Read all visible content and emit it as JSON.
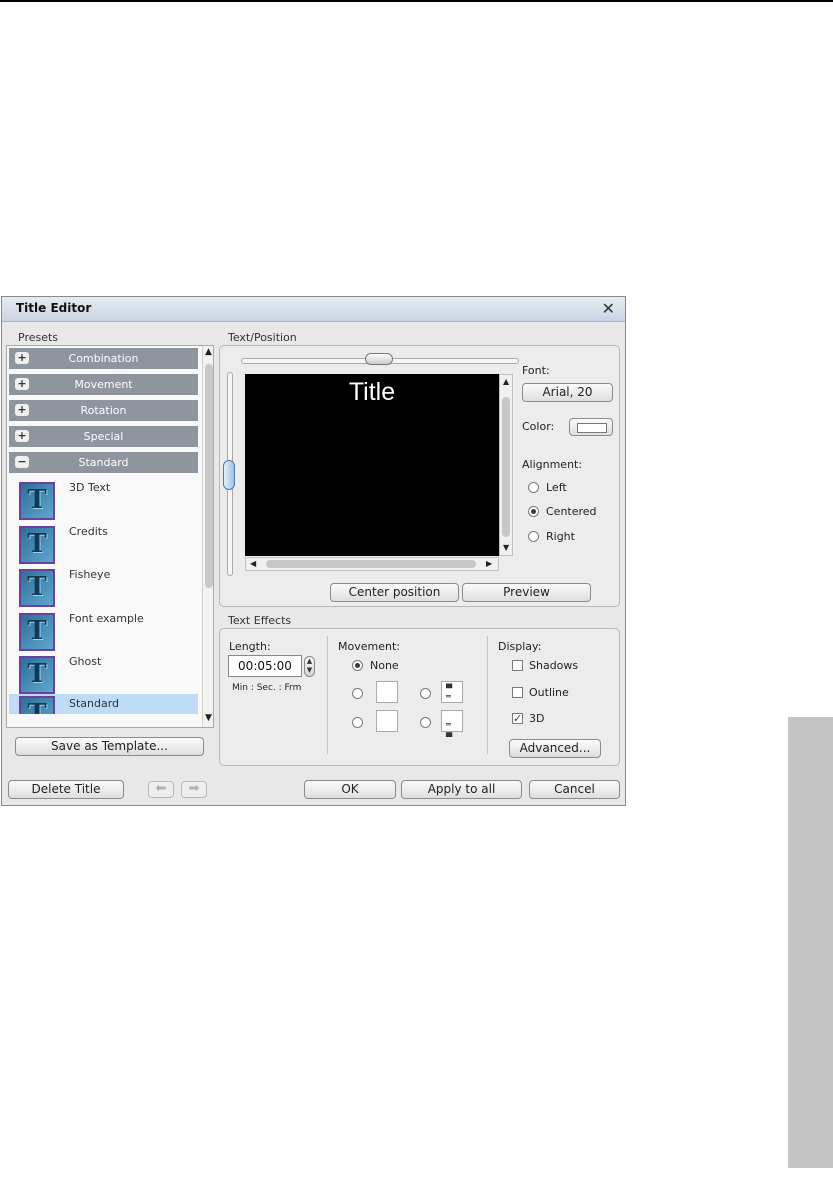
{
  "dialog": {
    "title": "Title Editor",
    "close": "✕"
  },
  "presets": {
    "label": "Presets",
    "categories": [
      {
        "label": "Combination",
        "toggle": "+"
      },
      {
        "label": "Movement",
        "toggle": "+"
      },
      {
        "label": "Rotation",
        "toggle": "+"
      },
      {
        "label": "Special",
        "toggle": "+"
      },
      {
        "label": "Standard",
        "toggle": "−"
      }
    ],
    "items": [
      {
        "label": "3D Text",
        "icon": "T"
      },
      {
        "label": "Credits",
        "icon": "T"
      },
      {
        "label": "Fisheye",
        "icon": "T"
      },
      {
        "label": "Font example",
        "icon": "T"
      },
      {
        "label": "Ghost",
        "icon": "T"
      },
      {
        "label": "Standard",
        "icon": "T",
        "selected": true
      }
    ],
    "save_template": "Save as Template..."
  },
  "text_position": {
    "label": "Text/Position",
    "preview_text": "Title",
    "font_label": "Font:",
    "font_value": "Arial, 20",
    "color_label": "Color:",
    "alignment_label": "Alignment:",
    "alignment_options": [
      "Left",
      "Centered",
      "Right"
    ],
    "alignment_selected": "Centered",
    "center_position": "Center position",
    "preview": "Preview"
  },
  "text_effects": {
    "label": "Text Effects",
    "length_label": "Length:",
    "length_value": "00:05:00",
    "length_format": "Min : Sec. : Frm",
    "movement_label": "Movement:",
    "movement_none": "None",
    "display_label": "Display:",
    "display_options": [
      {
        "label": "Shadows",
        "checked": false
      },
      {
        "label": "Outline",
        "checked": false
      },
      {
        "label": "3D",
        "checked": true
      }
    ],
    "advanced": "Advanced..."
  },
  "footer": {
    "delete_title": "Delete Title",
    "ok": "OK",
    "apply_all": "Apply to all",
    "cancel": "Cancel"
  },
  "colors": {
    "titlebar": "#c9d4e2",
    "category_bar": "#8e959f",
    "selected_item": "#bfdcf7",
    "canvas": "#000000"
  }
}
